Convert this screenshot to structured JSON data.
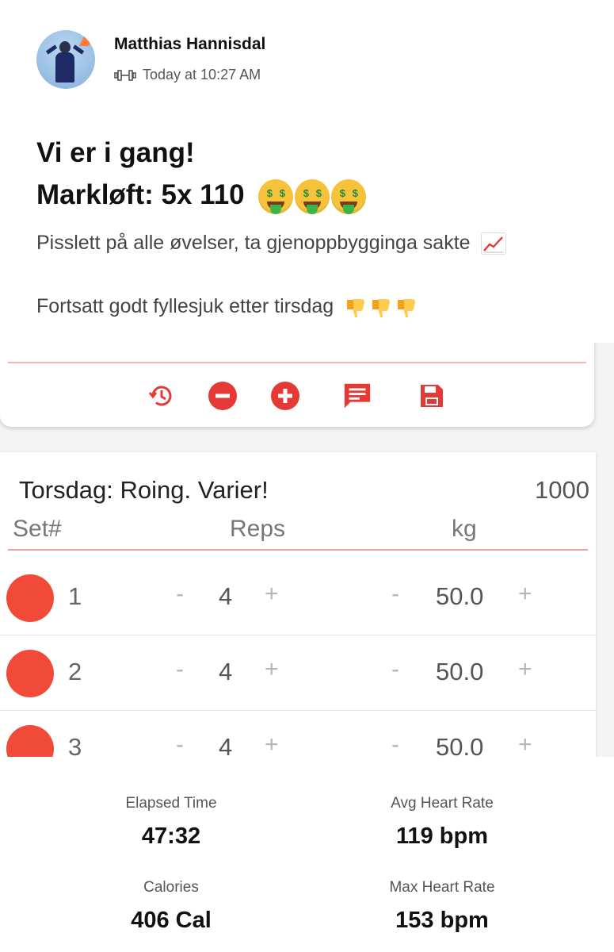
{
  "post": {
    "author": "Matthias Hannisdal",
    "timestamp": "Today at 10:27 AM",
    "activity_icon": "dumbbell-icon",
    "title_line1": "Vi er i gang!",
    "title_line2": "Markløft: 5x 110",
    "title_emoji": "money-mouth-face",
    "body_line1": "Pisslett på alle øvelser, ta gjenoppbygginga sakte",
    "body_line1_emoji": "chart-increasing",
    "body_line2": "Fortsatt godt fyllesjuk etter tirsdag",
    "body_line2_emoji": "thumbs-down"
  },
  "app": {
    "accent": "#e53935",
    "toolbar_icons": [
      "history-icon",
      "remove-circle-icon",
      "add-circle-icon",
      "comment-icon",
      "save-icon"
    ],
    "workout_title": "Torsdag: Roing. Varier!",
    "workout_value": "1000",
    "columns": {
      "set": "Set#",
      "reps": "Reps",
      "kg": "kg"
    },
    "rows": [
      {
        "set": "1",
        "reps": "4",
        "kg": "50.0",
        "minus": "-",
        "plus": "+"
      },
      {
        "set": "2",
        "reps": "4",
        "kg": "50.0",
        "minus": "-",
        "plus": "+"
      },
      {
        "set": "3",
        "reps": "4",
        "kg": "50.0",
        "minus": "-",
        "plus": "+"
      }
    ]
  },
  "stats": [
    {
      "label": "Elapsed Time",
      "value": "47:32"
    },
    {
      "label": "Avg Heart Rate",
      "value": "119 bpm"
    },
    {
      "label": "Calories",
      "value": "406 Cal"
    },
    {
      "label": "Max Heart Rate",
      "value": "153 bpm"
    }
  ]
}
